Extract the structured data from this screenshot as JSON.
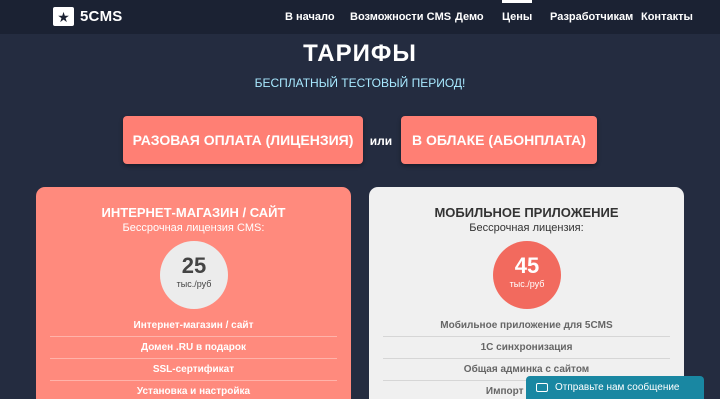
{
  "header": {
    "logo_icon": "star-icon",
    "logo_text": "5CMS",
    "nav": [
      "В начало",
      "Возможности CMS",
      "Демо",
      "Цены",
      "Разработчикам",
      "Контакты"
    ],
    "active_nav": "Цены"
  },
  "hero": {
    "title": "ТАРИФЫ",
    "subtitle": "БЕСПЛАТНЫЙ ТЕСТОВЫЙ ПЕРИОД!"
  },
  "toggle": {
    "option_license": "РАЗОВАЯ ОПЛАТА (ЛИЦЕНЗИЯ)",
    "or_label": "или",
    "option_cloud": "В ОБЛАКЕ (АБОНПЛАТА)"
  },
  "cards": [
    {
      "title": "ИНТЕРНЕТ-МАГАЗИН / САЙТ",
      "subtitle": "Бессрочная лицензия CMS:",
      "price": "25",
      "unit": "тыс./руб",
      "features": [
        "Интернет-магазин / сайт",
        "Домен .RU в подарок",
        "SSL-сертификат",
        "Установка и настройка"
      ]
    },
    {
      "title": "МОБИЛЬНОЕ ПРИЛОЖЕНИЕ",
      "subtitle": "Бессрочная лицензия:",
      "price": "45",
      "unit": "тыс./руб",
      "features": [
        "Мобильное приложение для 5CMS",
        "1С синхронизация",
        "Общая админка с сайтом",
        "Импорт товаров"
      ]
    }
  ],
  "chat": {
    "icon": "chat-icon",
    "label": "Отправьте нам сообщение"
  },
  "colors": {
    "background": "#242c40",
    "topbar": "#1b2233",
    "accent": "#ff7f74",
    "subtitle": "#a8e9ff",
    "chat": "#1987a2"
  }
}
